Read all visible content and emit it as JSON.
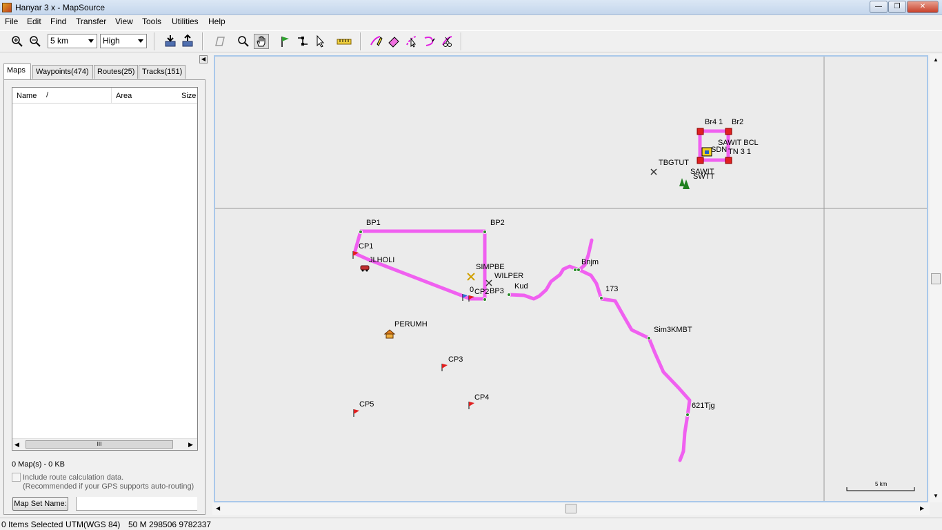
{
  "window": {
    "title": "Hanyar 3 x - MapSource"
  },
  "menu": [
    "File",
    "Edit",
    "Find",
    "Transfer",
    "View",
    "Tools",
    "Utilities",
    "Help"
  ],
  "toolbar": {
    "zoom_scale": "5 km",
    "detail": "High"
  },
  "tabs": [
    {
      "label": "Maps"
    },
    {
      "label": "Waypoints(474)"
    },
    {
      "label": "Routes(25)"
    },
    {
      "label": "Tracks(151)"
    }
  ],
  "maps_list": {
    "col_name": "Name",
    "col_sort": "/",
    "col_area": "Area",
    "col_size": "Size",
    "scroll_grip": "III"
  },
  "maps_summary": "0 Map(s) - 0 KB",
  "route_calc": {
    "checkbox_label": "Include route calculation data.",
    "hint": "(Recommended if your GPS supports auto-routing)"
  },
  "mapset": {
    "button_label": "Map Set Name:",
    "value": ""
  },
  "status": {
    "selected": "0 Items Selected",
    "datum": "UTM(WGS 84)",
    "position": "50 M 298506 9782337"
  },
  "map": {
    "scale_label": "5 km",
    "waypoints": [
      {
        "label": "Br4 1"
      },
      {
        "label": "Br2"
      },
      {
        "label": "SAWIT BCL"
      },
      {
        "label": "SDN"
      },
      {
        "label": "TN 3 1"
      },
      {
        "label": "TBGTUT"
      },
      {
        "label": "SAWIT"
      },
      {
        "label": "SWTT"
      },
      {
        "label": "BP1"
      },
      {
        "label": "BP2"
      },
      {
        "label": "CP1"
      },
      {
        "label": "JLHOLI"
      },
      {
        "label": "SIMPBE"
      },
      {
        "label": "WILPER"
      },
      {
        "label": "0"
      },
      {
        "label": "CP2"
      },
      {
        "label": "BP3"
      },
      {
        "label": "Kud"
      },
      {
        "label": "Bnjm"
      },
      {
        "label": "173"
      },
      {
        "label": "Sim3KMBT"
      },
      {
        "label": "621Tjg"
      },
      {
        "label": "PERUMH"
      },
      {
        "label": "CP3"
      },
      {
        "label": "CP4"
      },
      {
        "label": "CP5"
      }
    ]
  },
  "colors": {
    "track": "#f060f0",
    "waypoint_dot": "#2a8a2a",
    "flag": "#e02020",
    "map_bg": "#ebebeb"
  }
}
